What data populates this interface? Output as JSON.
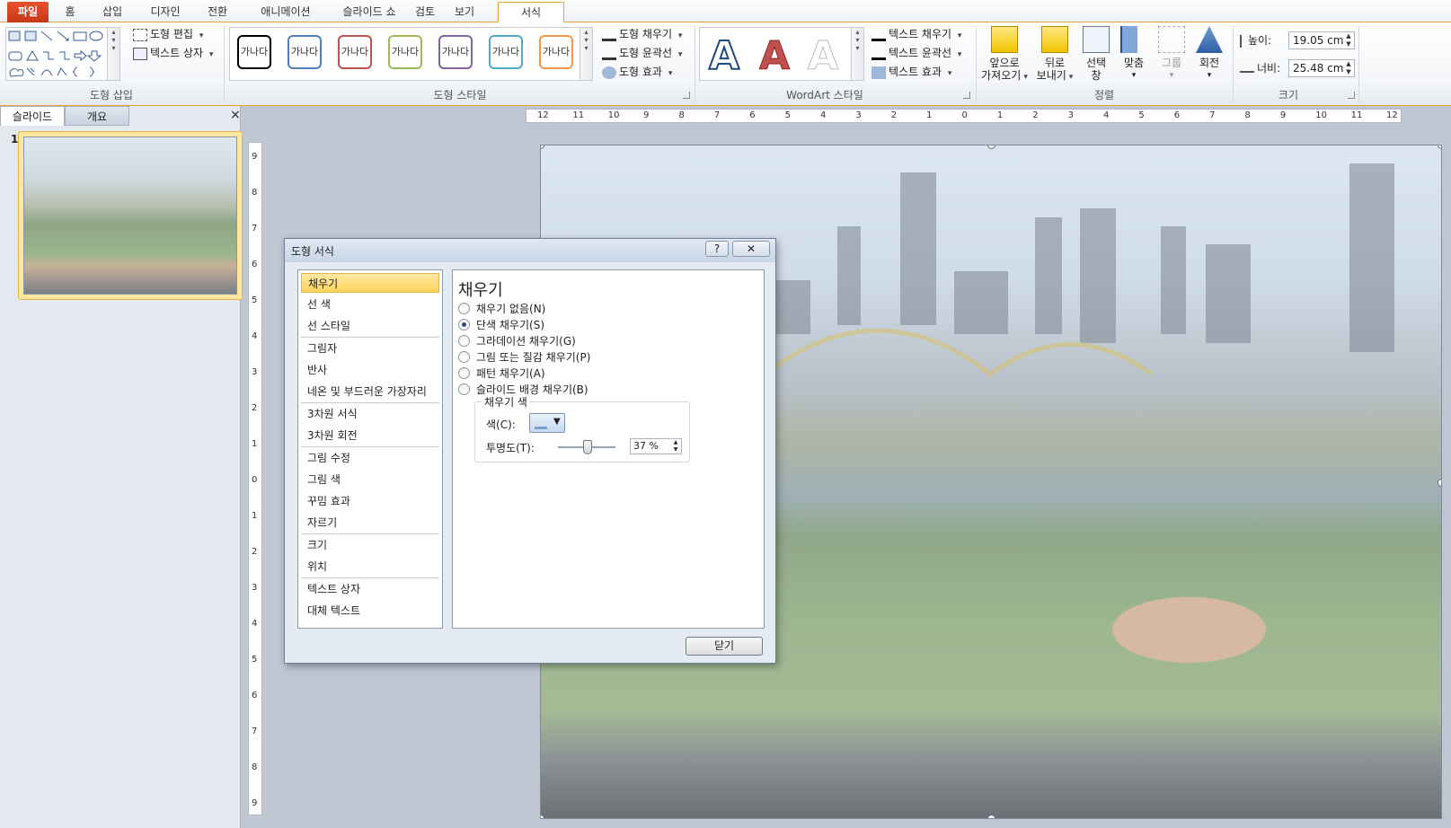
{
  "tabs": [
    "파일",
    "홈",
    "삽입",
    "디자인",
    "전환",
    "애니메이션",
    "슬라이드 쇼",
    "검토",
    "보기",
    "서식"
  ],
  "ribbon": {
    "shape_edit": "도형 편집",
    "text_box": "텍스트 상자",
    "group_insert_shapes": "도형 삽입",
    "style_sample": "가나다",
    "shape_fill": "도형 채우기",
    "shape_outline": "도형 윤곽선",
    "shape_effects": "도형 효과",
    "group_shape_styles": "도형 스타일",
    "wa_letter": "A",
    "text_fill": "텍스트 채우기",
    "text_outline": "텍스트 윤곽선",
    "text_effects": "텍스트 효과",
    "group_wordart": "WordArt 스타일",
    "bring_forward_1": "앞으로",
    "bring_forward_2": "가져오기",
    "send_backward_1": "뒤로",
    "send_backward_2": "보내기",
    "selection_pane_1": "선택",
    "selection_pane_2": "창",
    "align": "맞춤",
    "group_btn": "그룹",
    "rotate": "회전",
    "group_arrange": "정렬",
    "height_label": "높이:",
    "height_value": "19.05 cm",
    "width_label": "너비:",
    "width_value": "25.48 cm",
    "group_size": "크기"
  },
  "leftpane": {
    "tab_slides": "슬라이드",
    "tab_outline": "개요",
    "close": "×",
    "slide_number": "1"
  },
  "ruler": {
    "h_labels": [
      "12",
      "11",
      "10",
      "9",
      "8",
      "7",
      "6",
      "5",
      "4",
      "3",
      "2",
      "1",
      "0",
      "1",
      "2",
      "3",
      "4",
      "5",
      "6",
      "7",
      "8",
      "9",
      "10",
      "11",
      "12"
    ],
    "v_labels": [
      "9",
      "8",
      "7",
      "6",
      "5",
      "4",
      "3",
      "2",
      "1",
      "0",
      "1",
      "2",
      "3",
      "4",
      "5",
      "6",
      "7",
      "8",
      "9"
    ]
  },
  "dialog": {
    "title": "도형 서식",
    "help": "?",
    "close": "✕",
    "nav": [
      "채우기",
      "선 색",
      "선 스타일",
      "그림자",
      "반사",
      "네온 및 부드러운 가장자리",
      "3차원 서식",
      "3차원 회전",
      "그림 수정",
      "그림 색",
      "꾸밈 효과",
      "자르기",
      "크기",
      "위치",
      "텍스트 상자",
      "대체 텍스트"
    ],
    "heading": "채우기",
    "options": [
      "채우기 없음(N)",
      "단색 채우기(S)",
      "그라데이션 채우기(G)",
      "그림 또는 질감 채우기(P)",
      "패턴 채우기(A)",
      "슬라이드 배경 채우기(B)"
    ],
    "selected_option": 1,
    "fill_color_group": "채우기 색",
    "color_label": "색(C):",
    "transparency_label": "투명도(T):",
    "transparency_value": "37 %",
    "transparency_fraction": 0.37,
    "close_button": "닫기"
  }
}
